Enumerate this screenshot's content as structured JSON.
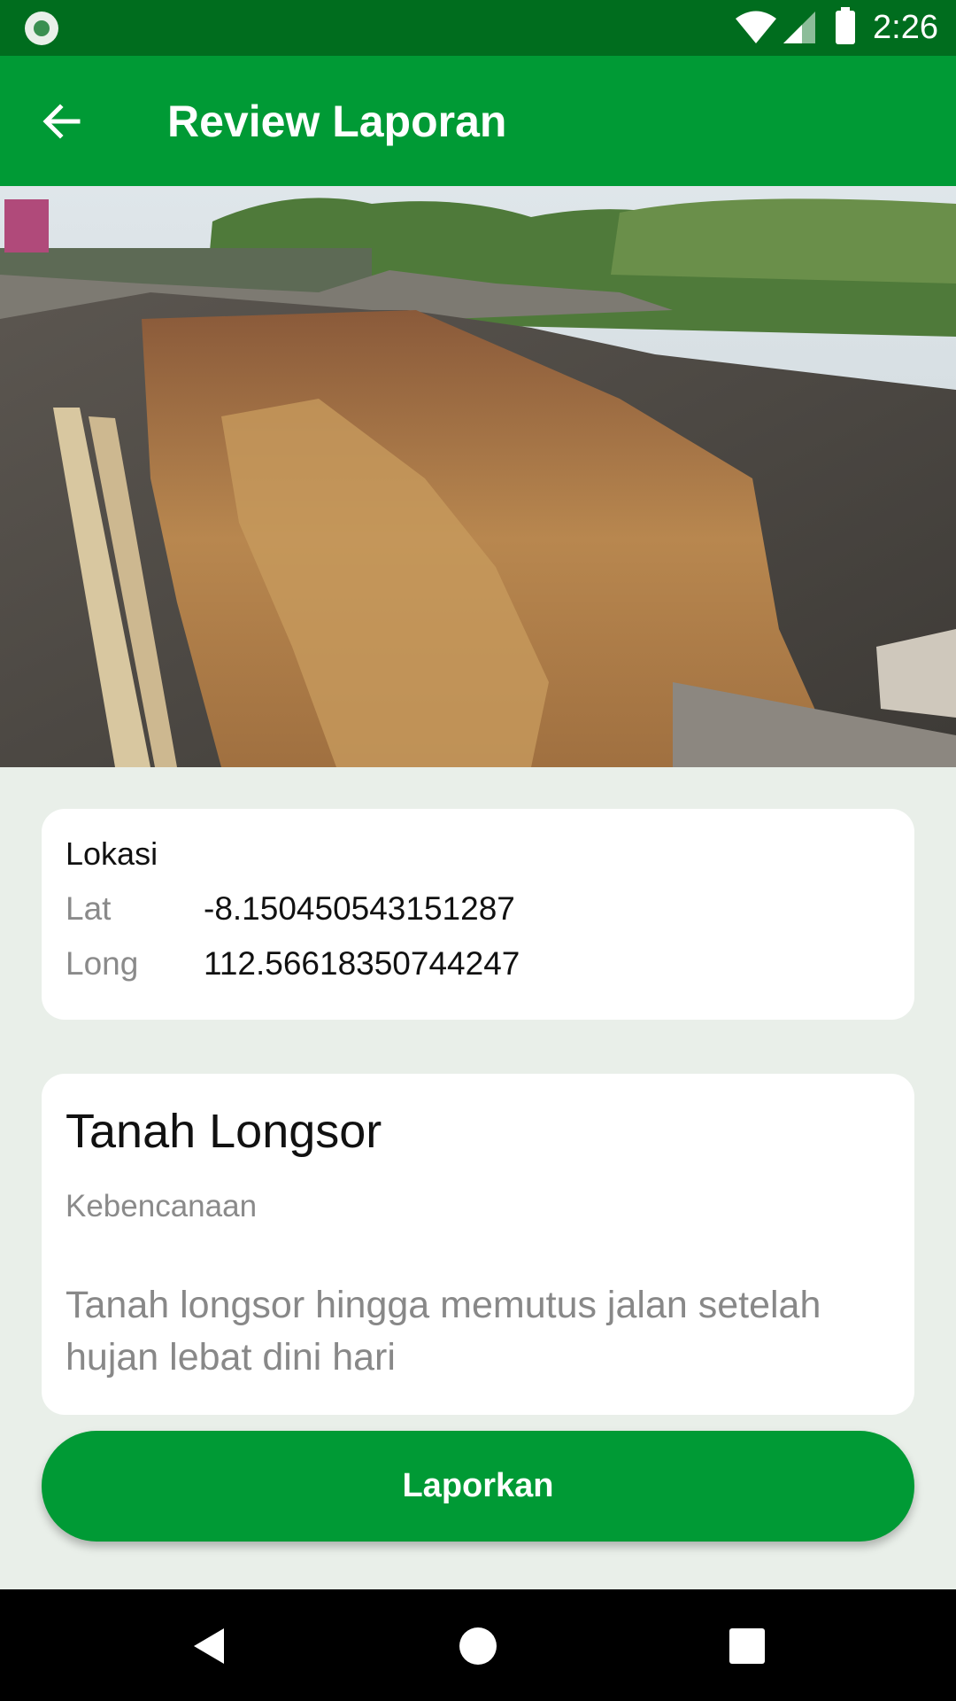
{
  "status_bar": {
    "time": "2:26",
    "icons": [
      "notification-icon",
      "wifi-icon",
      "signal-icon",
      "battery-icon"
    ]
  },
  "app_bar": {
    "title": "Review Laporan",
    "back_icon": "arrow-left-icon"
  },
  "photo": {
    "subject": "landslide-photo"
  },
  "location": {
    "heading": "Lokasi",
    "lat_label": "Lat",
    "lat_value": "-8.150450543151287",
    "long_label": "Long",
    "long_value": "112.56618350744247"
  },
  "report": {
    "title": "Tanah Longsor",
    "category": "Kebencanaan",
    "description": "Tanah longsor hingga memutus jalan setelah hujan lebat dini hari"
  },
  "submit": {
    "label": "Laporkan"
  },
  "colors": {
    "status_bar": "#006d1e",
    "primary": "#009a35",
    "background": "#e9efe9",
    "card": "#ffffff",
    "muted_text": "#8a8a8a"
  },
  "nav_bar": {
    "icons": [
      "nav-back-icon",
      "nav-home-icon",
      "nav-recents-icon"
    ]
  }
}
